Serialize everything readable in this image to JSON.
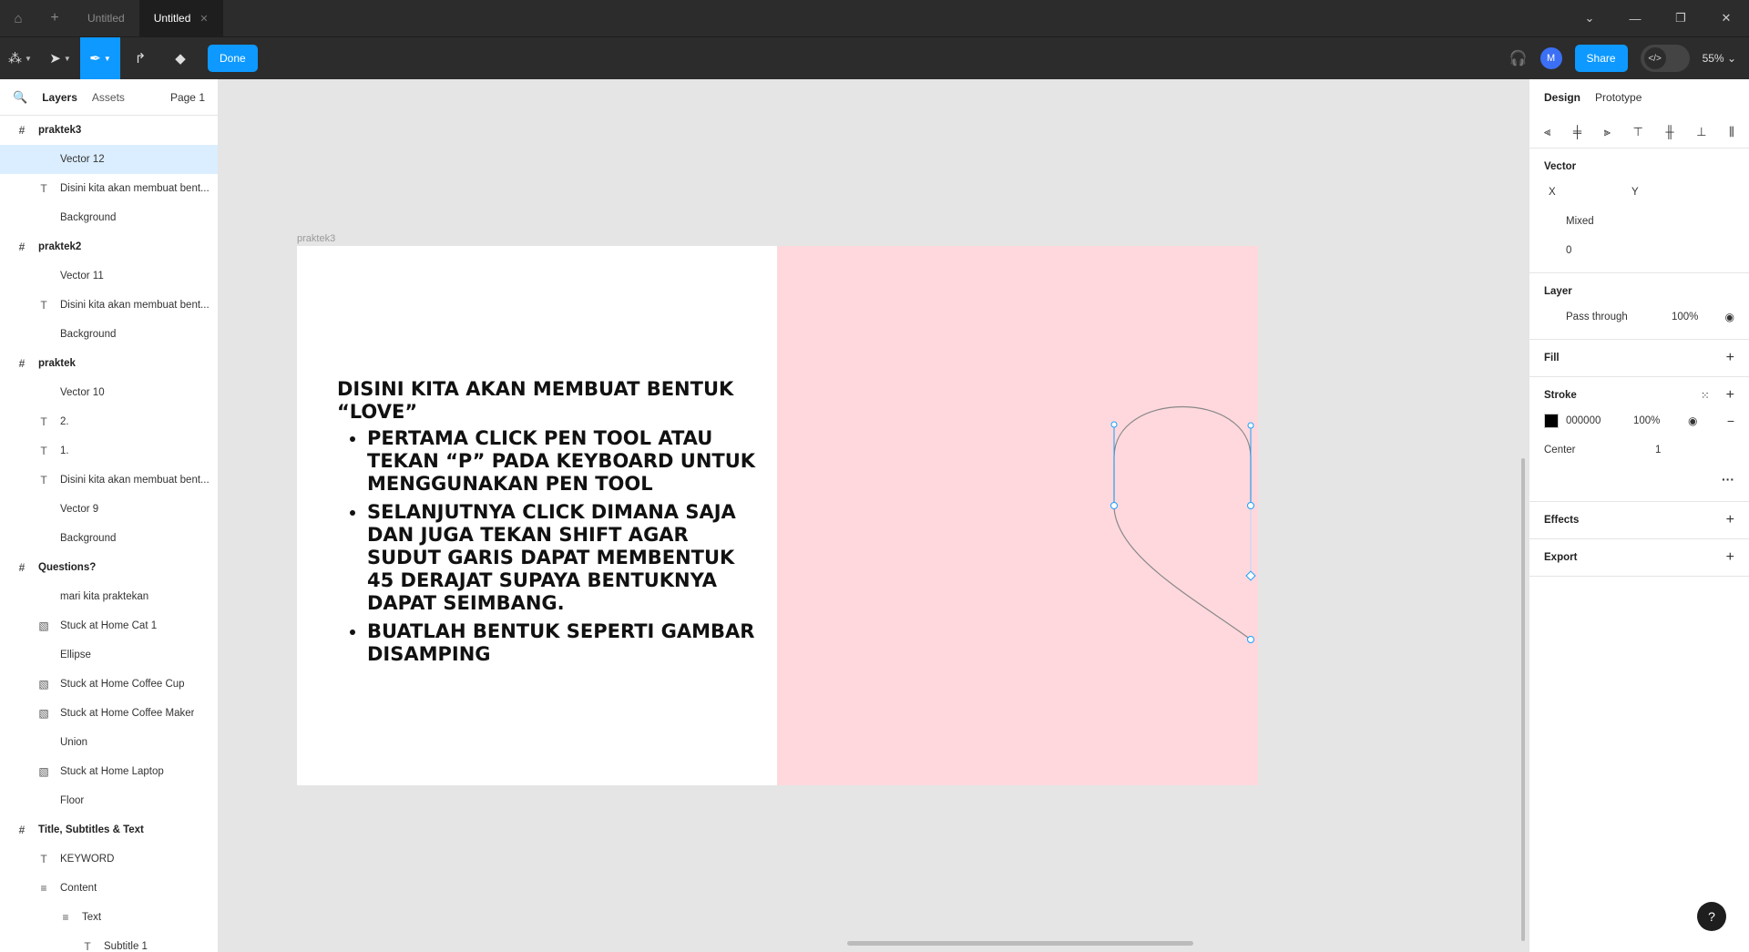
{
  "titlebar": {
    "tabs": [
      {
        "label": "Untitled",
        "active": false
      },
      {
        "label": "Untitled",
        "active": true
      }
    ]
  },
  "toolbar": {
    "done_label": "Done",
    "share_label": "Share",
    "avatar_initial": "M",
    "zoom": "55%"
  },
  "left_panel": {
    "tab_layers": "Layers",
    "tab_assets": "Assets",
    "page": "Page 1",
    "layers": [
      {
        "name": "praktek3",
        "type": "frame",
        "indent": 0
      },
      {
        "name": "Vector 12",
        "type": "vector",
        "indent": 1,
        "selected": true
      },
      {
        "name": "Disini kita akan membuat bent...",
        "type": "text",
        "indent": 1
      },
      {
        "name": "Background",
        "type": "rect",
        "indent": 1
      },
      {
        "name": "praktek2",
        "type": "frame",
        "indent": 0
      },
      {
        "name": "Vector 11",
        "type": "vector",
        "indent": 1
      },
      {
        "name": "Disini kita akan membuat bent...",
        "type": "text",
        "indent": 1
      },
      {
        "name": "Background",
        "type": "rect",
        "indent": 1
      },
      {
        "name": "praktek",
        "type": "frame",
        "indent": 0
      },
      {
        "name": "Vector 10",
        "type": "vector",
        "indent": 1
      },
      {
        "name": "2.",
        "type": "text",
        "indent": 1
      },
      {
        "name": "1.",
        "type": "text",
        "indent": 1
      },
      {
        "name": "Disini kita akan membuat bent...",
        "type": "text",
        "indent": 1
      },
      {
        "name": "Vector 9",
        "type": "vector",
        "indent": 1
      },
      {
        "name": "Background",
        "type": "rect",
        "indent": 1
      },
      {
        "name": "Questions?",
        "type": "frame",
        "indent": 0
      },
      {
        "name": "mari kita praktekan",
        "type": "vector",
        "indent": 1
      },
      {
        "name": "Stuck at Home Cat 1",
        "type": "image",
        "indent": 1
      },
      {
        "name": "Ellipse",
        "type": "vector",
        "indent": 1
      },
      {
        "name": "Stuck at Home Coffee Cup",
        "type": "image",
        "indent": 1
      },
      {
        "name": "Stuck at Home Coffee Maker",
        "type": "image",
        "indent": 1
      },
      {
        "name": "Union",
        "type": "vector",
        "indent": 1
      },
      {
        "name": "Stuck at Home Laptop",
        "type": "image",
        "indent": 1
      },
      {
        "name": "Floor",
        "type": "vector",
        "indent": 1
      },
      {
        "name": "Title, Subtitles & Text",
        "type": "frame",
        "indent": 0
      },
      {
        "name": "KEYWORD",
        "type": "text",
        "indent": 1
      },
      {
        "name": "Content",
        "type": "autolayout",
        "indent": 1
      },
      {
        "name": "Text",
        "type": "autolayout",
        "indent": 2
      },
      {
        "name": "Subtitle 1",
        "type": "text",
        "indent": 3
      }
    ]
  },
  "canvas": {
    "frame_label": "praktek3",
    "heading": "DISINI KITA AKAN MEMBUAT BENTUK “LOVE”",
    "bullets": [
      "PERTAMA CLICK PEN TOOL ATAU TEKAN “P” PADA KEYBOARD UNTUK MENGGUNAKAN PEN TOOL",
      "SELANJUTNYA CLICK DIMANA SAJA DAN JUGA TEKAN SHIFT AGAR SUDUT GARIS DAPAT MEMBENTUK 45 DERAJAT SUPAYA BENTUKNYA DAPAT SEIMBANG.",
      "BUATLAH BENTUK SEPERTI GAMBAR DISAMPING"
    ],
    "pink_color": "#fed8dd"
  },
  "right_panel": {
    "tab_design": "Design",
    "tab_prototype": "Prototype",
    "vector_title": "Vector",
    "x_label": "X",
    "y_label": "Y",
    "mixed": "Mixed",
    "rotation": "0",
    "layer_title": "Layer",
    "blend_mode": "Pass through",
    "layer_opacity": "100%",
    "fill_title": "Fill",
    "stroke_title": "Stroke",
    "stroke_color": "000000",
    "stroke_opacity": "100%",
    "stroke_position": "Center",
    "stroke_weight": "1",
    "effects_title": "Effects",
    "export_title": "Export"
  },
  "help": "?"
}
